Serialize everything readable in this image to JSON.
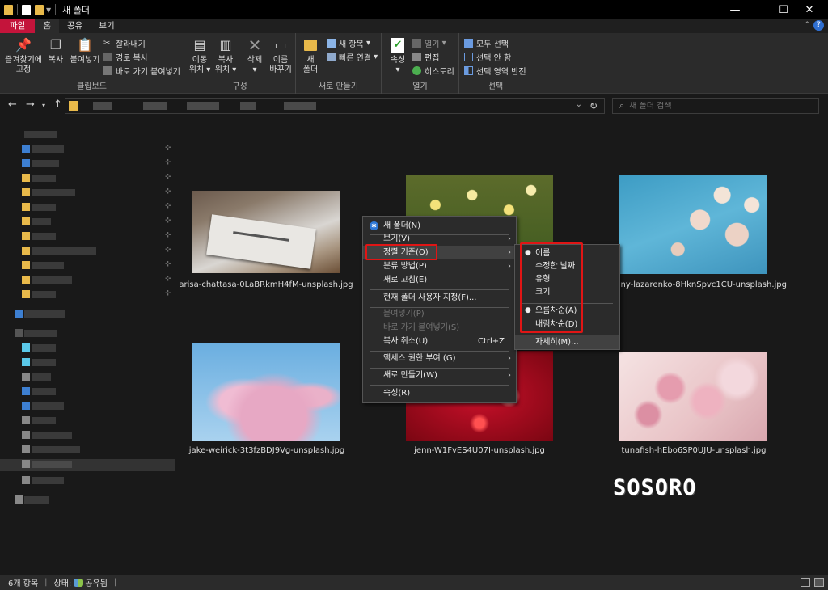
{
  "window": {
    "title": "새 폴더",
    "minimize": "—",
    "maximize": "☐",
    "close": "✕"
  },
  "ribbon_tabs": [
    "파일",
    "홈",
    "공유",
    "보기"
  ],
  "ribbon": {
    "clipboard": {
      "pin_label_1": "즐겨찾기에",
      "pin_label_2": "고정",
      "copy": "복사",
      "paste": "붙여넣기",
      "cut": "잘라내기",
      "copy_path": "경로 복사",
      "paste_shortcut": "바로 가기 붙여넣기",
      "group": "클립보드"
    },
    "organize": {
      "move_1": "이동",
      "move_2": "위치",
      "copyto_1": "복사",
      "copyto_2": "위치",
      "delete": "삭제",
      "rename_1": "이름",
      "rename_2": "바꾸기",
      "group": "구성"
    },
    "new": {
      "folder_1": "새",
      "folder_2": "폴더",
      "new_item": "새 항목",
      "easy_access": "빠른 연결",
      "group": "새로 만들기"
    },
    "open": {
      "properties": "속성",
      "open": "열기",
      "edit": "편집",
      "history": "히스토리",
      "group": "열기"
    },
    "select": {
      "select_all": "모두 선택",
      "select_none": "선택 안 함",
      "invert": "선택 영역 반전",
      "group": "선택"
    }
  },
  "search": {
    "placeholder": "새 폴더 검색"
  },
  "files": [
    {
      "name": "arisa-chattasa-0LaBRkmH4fM-unsplash.jpg"
    },
    {
      "name": ""
    },
    {
      "name": "evgeny-lazarenko-8HknSpvc1CU-unsplash.jpg"
    },
    {
      "name": "jake-weirick-3t3fzBDJ9Vg-unsplash.jpg"
    },
    {
      "name": "jenn-W1FvES4U07I-unsplash.jpg"
    },
    {
      "name": "tunafish-hEbo6SP0UJU-unsplash.jpg"
    }
  ],
  "context_menu": {
    "new_folder": "새 폴더(N)",
    "view": "보기(V)",
    "sort_by": "정렬 기준(O)",
    "group_by": "분류 방법(P)",
    "refresh": "새로 고침(E)",
    "customize": "현재 폴더 사용자 지정(F)...",
    "paste": "붙여넣기(P)",
    "paste_shortcut": "바로 가기 붙여넣기(S)",
    "undo_copy": "복사 취소(U)",
    "undo_shortcut": "Ctrl+Z",
    "give_access": "액세스 권한 부여 (G)",
    "new": "새로 만들기(W)",
    "properties": "속성(R)"
  },
  "sort_submenu": {
    "name": "이름",
    "date_modified": "수정한 날짜",
    "type": "유형",
    "size": "크기",
    "ascending": "오름차순(A)",
    "descending": "내림차순(D)",
    "more": "자세히(M)..."
  },
  "status": {
    "count": "6개 항목",
    "state": "상태:",
    "shared": "공유됨"
  },
  "watermark": "SOSORO",
  "colors": {
    "accent": "#c4143b",
    "highlight": "#e01515"
  }
}
